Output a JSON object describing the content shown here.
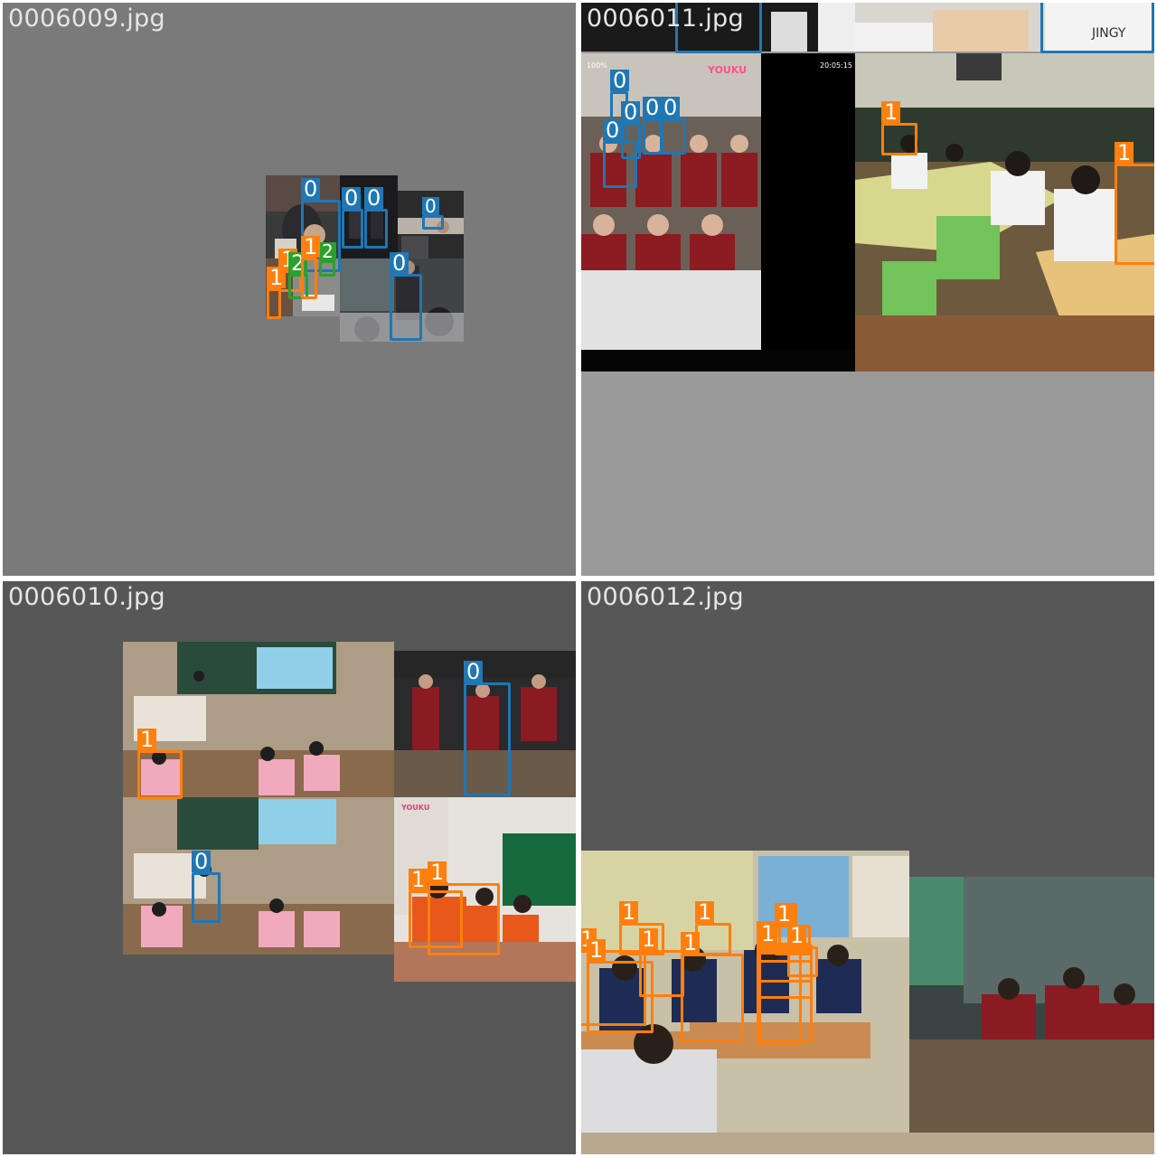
{
  "mosaic": {
    "tiles": [
      {
        "name": "0006009.jpg",
        "background": "#7a7a7a"
      },
      {
        "name": "0006011.jpg",
        "background": "#9a9a9a"
      },
      {
        "name": "0006010.jpg",
        "background": "#575757"
      },
      {
        "name": "0006012.jpg",
        "background": "#575757"
      }
    ]
  },
  "classes": {
    "c0": {
      "label": "0",
      "color": "#1f77b4"
    },
    "c1": {
      "label": "1",
      "color": "#ff7f0e"
    },
    "c2": {
      "label": "2",
      "color": "#2ca02c"
    }
  },
  "overlays": {
    "youku_logo": "YOUKU",
    "timestamp": "20:05:15",
    "progress_pct": "100%",
    "brand_text": "JINGY",
    "youku_logo_small": "YOUKU"
  }
}
